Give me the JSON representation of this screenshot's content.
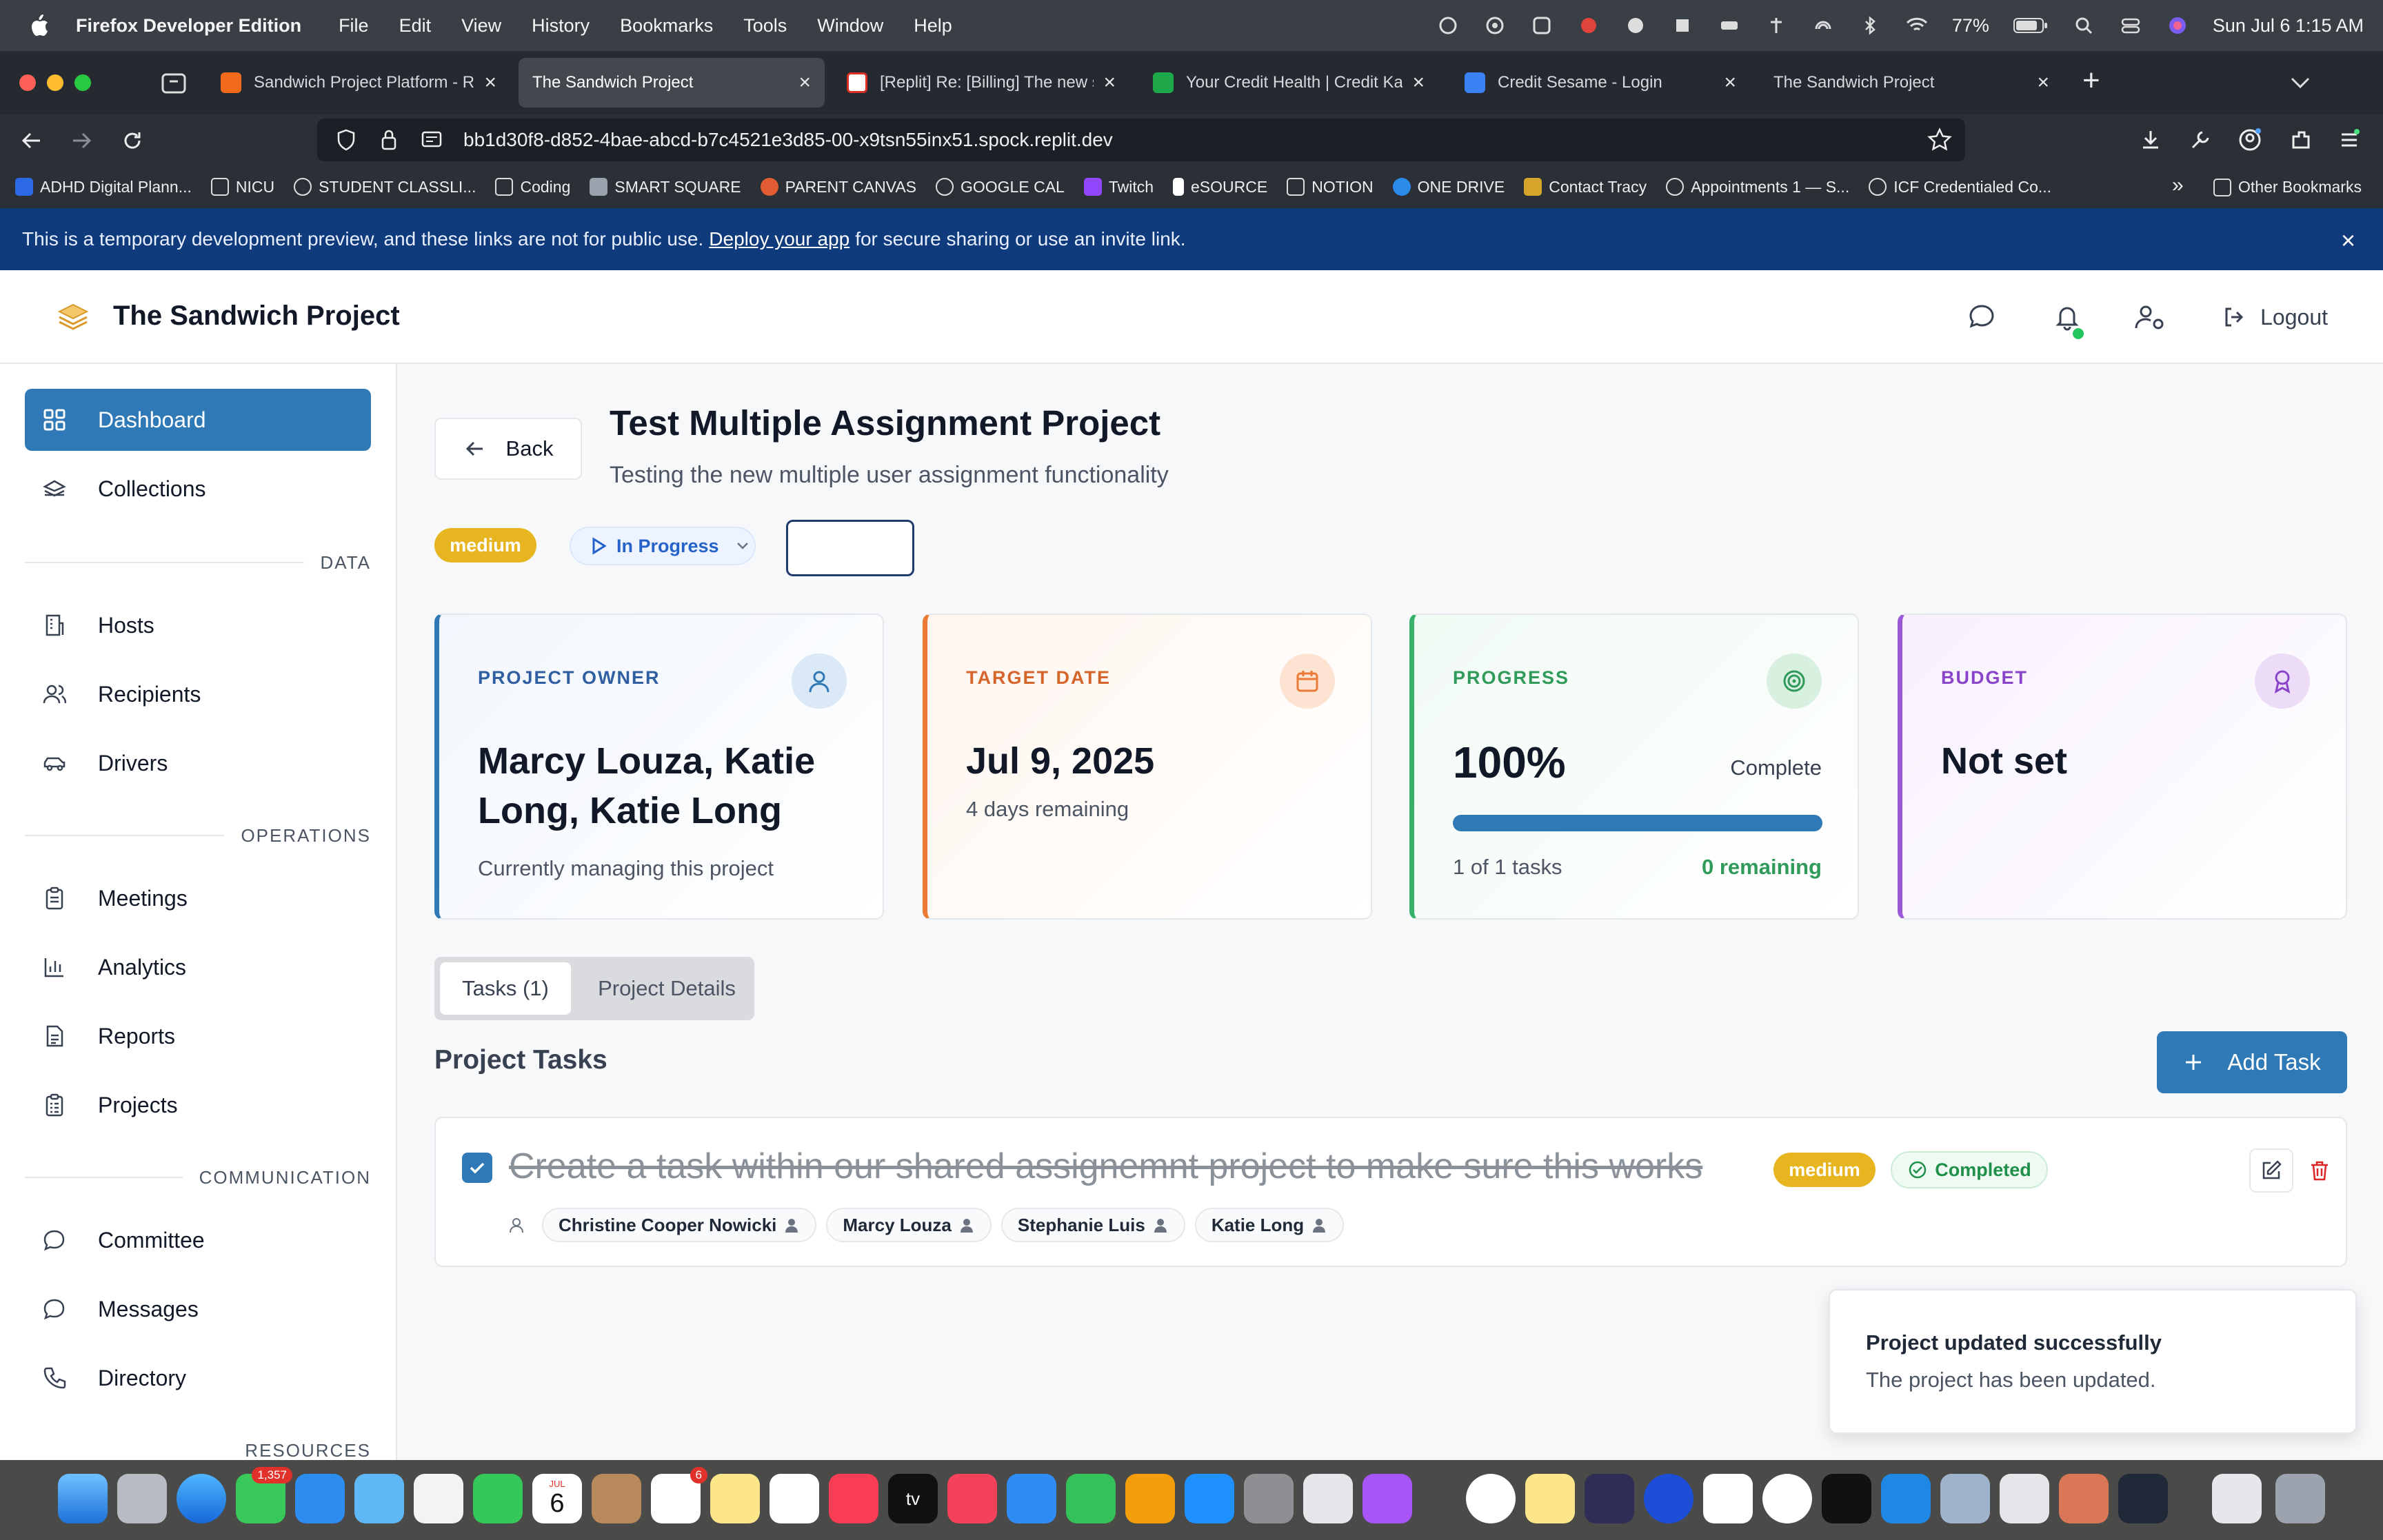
{
  "menubar": {
    "app_name": "Firefox Developer Edition",
    "menus": [
      "File",
      "Edit",
      "View",
      "History",
      "Bookmarks",
      "Tools",
      "Window",
      "Help"
    ],
    "battery": "77%",
    "datetime": "Sun Jul 6  1:15 AM"
  },
  "browser": {
    "tabs": [
      {
        "title": "Sandwich Project Platform - Rep",
        "favicon_color": "#f26b1d"
      },
      {
        "title": "The Sandwich Project",
        "favicon_color": ""
      },
      {
        "title": "[Replit] Re: [Billing] The new set",
        "favicon_color": "#d93025"
      },
      {
        "title": "Your Credit Health | Credit Karm",
        "favicon_color": "#1ea84a"
      },
      {
        "title": "Credit Sesame - Login",
        "favicon_color": "#3b82f6"
      },
      {
        "title": "The Sandwich Project",
        "favicon_color": ""
      }
    ],
    "new_tab_label": "+",
    "url": "bb1d30f8-d852-4bae-abcd-b7c4521e3d85-00-x9tsn55inx51.spock.replit.dev",
    "bookmarks": [
      "ADHD Digital Plann...",
      "NICU",
      "STUDENT CLASSLI...",
      "Coding",
      "SMART SQUARE",
      "PARENT CANVAS",
      "GOOGLE CAL",
      "Twitch",
      "eSOURCE",
      "NOTION",
      "ONE DRIVE",
      "Contact Tracy",
      "Appointments 1 — S...",
      "ICF Credentialed Co..."
    ],
    "other_bookmarks": "Other Bookmarks"
  },
  "banner": {
    "text_before": "This is a temporary development preview, and these links are not for public use.",
    "link": "Deploy your app",
    "text_after": "for secure sharing or use an invite link.",
    "close": "×"
  },
  "header": {
    "brand": "The Sandwich Project",
    "logout": "Logout",
    "notification_dot_color": "#22c55e"
  },
  "sidebar": {
    "items": [
      {
        "label": "Dashboard",
        "icon": "grid-icon"
      },
      {
        "label": "Collections",
        "icon": "sandwich-icon"
      },
      {
        "label": "Hosts",
        "icon": "building-icon"
      },
      {
        "label": "Recipients",
        "icon": "users-icon"
      },
      {
        "label": "Drivers",
        "icon": "car-icon"
      },
      {
        "label": "Meetings",
        "icon": "clipboard-icon"
      },
      {
        "label": "Analytics",
        "icon": "bar-chart-icon"
      },
      {
        "label": "Reports",
        "icon": "document-icon"
      },
      {
        "label": "Projects",
        "icon": "clipboard-list-icon"
      },
      {
        "label": "Committee",
        "icon": "chat-bubble-icon"
      },
      {
        "label": "Messages",
        "icon": "chat-bubble-icon"
      },
      {
        "label": "Directory",
        "icon": "phone-icon"
      }
    ],
    "sections": {
      "data": "DATA",
      "operations": "OPERATIONS",
      "communication": "COMMUNICATION",
      "resources": "RESOURCES"
    }
  },
  "project": {
    "back": "Back",
    "title": "Test Multiple Assignment Project",
    "description": "Testing the new multiple user assignment functionality",
    "priority": "medium",
    "status": "In Progress",
    "cards": {
      "owner": {
        "label": "PROJECT OWNER",
        "value": "Marcy Louza, Katie Long, Katie Long",
        "sub": "Currently managing this project"
      },
      "target": {
        "label": "TARGET DATE",
        "value": "Jul 9, 2025",
        "sub": "4 days remaining"
      },
      "progress": {
        "label": "PROGRESS",
        "value": "100%",
        "complete_label": "Complete",
        "fraction": 1.0,
        "tasks_text": "1 of 1 tasks",
        "remaining_text": "0 remaining"
      },
      "budget": {
        "label": "BUDGET",
        "value": "Not set"
      }
    },
    "tabs": {
      "tasks": "Tasks (1)",
      "details": "Project Details"
    },
    "tasks_heading": "Project Tasks",
    "add_task": "Add Task",
    "tasks": [
      {
        "title": "Create a task within our shared assignemnt project to make sure this works",
        "priority": "medium",
        "status": "Completed",
        "assignees": [
          "Christine Cooper Nowicki",
          "Marcy Louza",
          "Stephanie Luis",
          "Katie Long"
        ]
      }
    ]
  },
  "toast": {
    "title": "Project updated successfully",
    "message": "The project has been updated."
  },
  "dock": {
    "messages_badge": "1,357",
    "calendar_month": "JUL",
    "calendar_day": "6",
    "reminders_badge": "6",
    "tv_label": "tv"
  },
  "colors": {
    "primary": "#2f7ab6",
    "banner": "#0f3a7c",
    "medium_badge": "#e6b520",
    "owner_accent": "#2f7ab6",
    "target_accent": "#ea7a35",
    "progress_accent": "#38b26a",
    "budget_accent": "#9b59d6"
  }
}
